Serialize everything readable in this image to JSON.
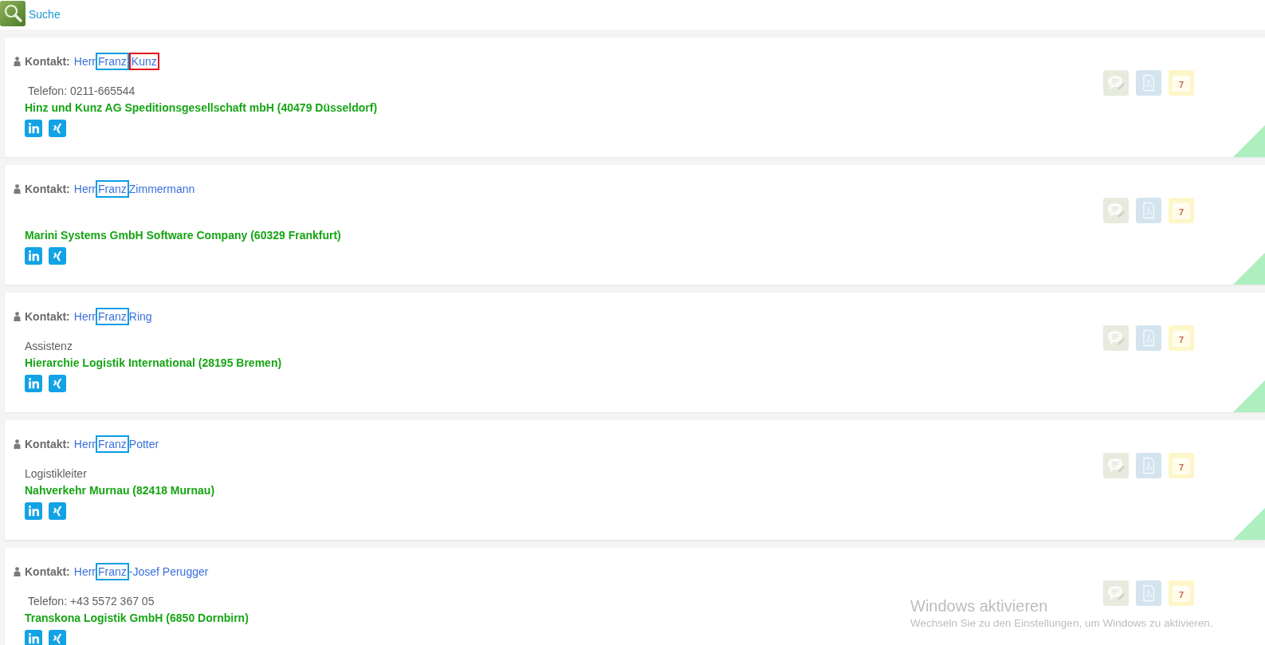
{
  "header": {
    "search_link": "Suche"
  },
  "contacts": [
    {
      "label": "Kontakt:",
      "name_parts": [
        {
          "text": "Herr"
        },
        {
          "text": "Franz",
          "color": "#0a9fe2"
        },
        {
          "text": "Kunz",
          "color": "#e3111b"
        }
      ],
      "detail": {
        "kind": "phone",
        "text": "Telefon: 0211-665544"
      },
      "company": "Hinz und Kunz AG Speditionsgesellschaft mbH (40479 Düsseldorf)",
      "socials": [
        {
          "kind": "linkedin"
        },
        {
          "kind": "xing"
        }
      ],
      "actions": [
        {
          "kind": "note"
        },
        {
          "kind": "pdf"
        },
        {
          "kind": "calendar",
          "label": "7"
        }
      ]
    },
    {
      "label": "Kontakt:",
      "name_parts": [
        {
          "text": "Herr"
        },
        {
          "text": "Franz",
          "color": "#0a9fe2"
        },
        {
          "text": "Zimmermann"
        }
      ],
      "company": "Marini Systems GmbH Software Company (60329 Frankfurt)",
      "socials": [
        {
          "kind": "linkedin"
        },
        {
          "kind": "xing"
        }
      ],
      "actions": [
        {
          "kind": "note"
        },
        {
          "kind": "pdf"
        },
        {
          "kind": "calendar",
          "label": "7"
        }
      ]
    },
    {
      "label": "Kontakt:",
      "name_parts": [
        {
          "text": "Herr"
        },
        {
          "text": "Franz",
          "color": "#0a9fe2"
        },
        {
          "text": "Ring"
        }
      ],
      "detail": {
        "kind": "role",
        "text": "Assistenz"
      },
      "company": "Hierarchie Logistik International (28195 Bremen)",
      "socials": [
        {
          "kind": "linkedin"
        },
        {
          "kind": "xing"
        }
      ],
      "actions": [
        {
          "kind": "note"
        },
        {
          "kind": "pdf"
        },
        {
          "kind": "calendar",
          "label": "7"
        }
      ]
    },
    {
      "label": "Kontakt:",
      "name_parts": [
        {
          "text": "Herr"
        },
        {
          "text": "Franz",
          "color": "#0a9fe2"
        },
        {
          "text": "Potter"
        }
      ],
      "detail": {
        "kind": "role",
        "text": "Logistikleiter"
      },
      "company": "Nahverkehr Murnau (82418 Murnau)",
      "socials": [
        {
          "kind": "linkedin"
        },
        {
          "kind": "xing"
        }
      ],
      "actions": [
        {
          "kind": "note"
        },
        {
          "kind": "pdf"
        },
        {
          "kind": "calendar",
          "label": "7"
        }
      ]
    },
    {
      "label": "Kontakt:",
      "name_parts": [
        {
          "text": "Herr"
        },
        {
          "text": "Franz",
          "color": "#0a9fe2"
        },
        {
          "text": "-Josef Perugger"
        }
      ],
      "detail": {
        "kind": "phone",
        "text": "Telefon: +43 5572 367 05"
      },
      "company": "Transkona Logistik GmbH (6850 Dornbirn)",
      "socials": [
        {
          "kind": "linkedin"
        },
        {
          "kind": "xing"
        }
      ],
      "actions": [
        {
          "kind": "note"
        },
        {
          "kind": "pdf"
        },
        {
          "kind": "calendar",
          "label": "7"
        }
      ]
    }
  ],
  "windows_notice": {
    "title": "Windows aktivieren",
    "text": "Wechseln Sie zu den Einstellungen, um Windows zu aktivieren."
  }
}
